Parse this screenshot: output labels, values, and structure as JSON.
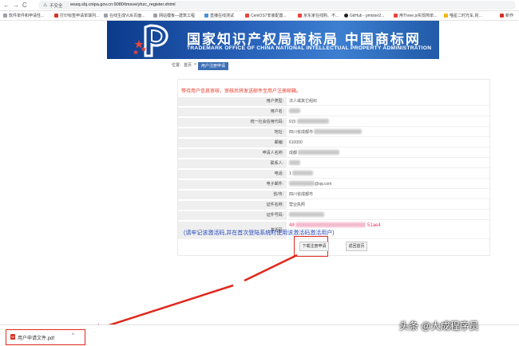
{
  "browser": {
    "security_label": "不安全",
    "url": "wssq.sbj.cnipa.gov.cn:9080/tmsve/yhzc_register.xhtml",
    "bookmarks": [
      "软件单件和申请性...",
      "打印标签申请单填列...",
      "在线生成VUE页面...",
      "网站模板—建筑工程",
      "直播在线测试",
      "CentOS7安装配置...",
      "京东家在线购、不...",
      "GitHub - pmister2...",
      "用Three.js实现简单...",
      "喵星二时光车,昆…",
      "新作"
    ]
  },
  "banner": {
    "title": "国家知识产权局商标局 中国商标网",
    "subtitle": "TRADEMARK OFFICE OF CHINA NATIONAL INTELLECTUAL PROPERTY ADMINISTRATION"
  },
  "breadcrumb": {
    "location_label": "位置:",
    "home": "首页",
    "separator": ">",
    "current": "用户注册申请"
  },
  "form": {
    "notice": "等待用户信息审核，审核后将发送邮件至用户注册邮箱。",
    "rows": [
      {
        "label": "用户类型:",
        "value": "法人或其它组织"
      },
      {
        "label": "用户名:",
        "value": ""
      },
      {
        "label": "统一社会信用代码:",
        "value": "915"
      },
      {
        "label": "地址:",
        "value": "四川省成都市"
      },
      {
        "label": "邮编:",
        "value": "610000"
      },
      {
        "label": "申请人名称:",
        "value": "成都"
      },
      {
        "label": "联系人:",
        "value": ""
      },
      {
        "label": "电话:",
        "value": "1"
      },
      {
        "label": "电子邮件:",
        "value": "@qq.com"
      },
      {
        "label": "省/市:",
        "value": "四川省成都市"
      },
      {
        "label": "证件名称:",
        "value": "营业执照"
      },
      {
        "label": "证件号码:",
        "value": ""
      },
      {
        "label": "激活码:",
        "value": "48"
      }
    ],
    "activation_code_tail": "51ae4",
    "activation_hint": "(请牢记该激活码,并在首次登陆系统时使用该激活码激活用户)",
    "download_button": "下载注册申请",
    "home_button": "返回首页"
  },
  "downloads": {
    "file_name": "用户申请文件.pdf",
    "chevron": "^"
  },
  "watermark": "头条 @大成程序员",
  "colors": {
    "notice": "#e53a2a",
    "highlight": "#e0281c",
    "banner": "#1f4fa0",
    "hint": "#2346b8"
  }
}
